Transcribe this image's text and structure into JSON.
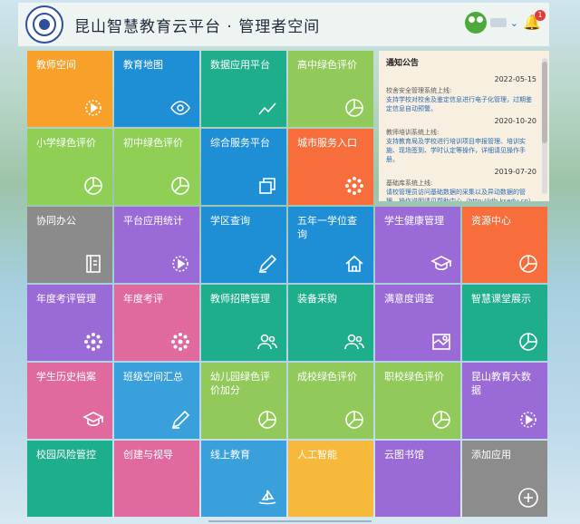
{
  "header": {
    "title": "昆山智慧教育云平台 · 管理者空间",
    "badge_count": "1"
  },
  "colors": {
    "orange": "#f7a02a",
    "blue": "#1e8ed5",
    "teal": "#1fae8c",
    "green": "#91c95a",
    "lightgreen": "#8fcf55",
    "purple": "#9a6ad6",
    "gray": "#8b8b8b",
    "pink": "#e06a9e",
    "red": "#f76d3b",
    "yellow": "#f6b93b",
    "sky": "#3aa0dc",
    "darkgray": "#8c8c8c"
  },
  "tiles": [
    {
      "label": "教师空间",
      "icon": "play-gear-icon"
    },
    {
      "label": "教育地图",
      "icon": "eye-icon"
    },
    {
      "label": "数据应用平台",
      "icon": "line-chart-icon"
    },
    {
      "label": "高中绿色评价",
      "icon": "pie-chart-icon"
    },
    {
      "label": "小学绿色评价",
      "icon": "pie-chart-icon"
    },
    {
      "label": "初中绿色评价",
      "icon": "pie-chart-icon"
    },
    {
      "label": "综合服务平台",
      "icon": "window-icon"
    },
    {
      "label": "城市服务入口",
      "icon": "dots-circle-icon"
    },
    {
      "label": "协同办公",
      "icon": "book-icon"
    },
    {
      "label": "平台应用统计",
      "icon": "play-gear-icon"
    },
    {
      "label": "学区查询",
      "icon": "pencil-icon"
    },
    {
      "label": "五年一学位查询",
      "icon": "house-icon"
    },
    {
      "label": "学生健康管理",
      "icon": "graduation-cap-icon"
    },
    {
      "label": "资源中心",
      "icon": "pie-chart-icon"
    },
    {
      "label": "年度考评管理",
      "icon": "dots-circle-icon"
    },
    {
      "label": "年度考评",
      "icon": "dots-circle-icon"
    },
    {
      "label": "教师招聘管理",
      "icon": "people-icon"
    },
    {
      "label": "装备采购",
      "icon": "people-icon"
    },
    {
      "label": "满意度调查",
      "icon": "map-icon"
    },
    {
      "label": "智慧课堂展示",
      "icon": "pie-chart-icon"
    },
    {
      "label": "学生历史档案",
      "icon": "graduation-cap-icon"
    },
    {
      "label": "班级空间汇总",
      "icon": "pencil-icon"
    },
    {
      "label": "幼儿园绿色评价加分",
      "icon": "pie-chart-icon"
    },
    {
      "label": "成校绿色评价",
      "icon": "pie-chart-icon"
    },
    {
      "label": "职校绿色评价",
      "icon": "pie-chart-icon"
    },
    {
      "label": "昆山教育大数据",
      "icon": "play-gear-icon"
    },
    {
      "label": "校园风险管控",
      "icon": ""
    },
    {
      "label": "创建与视导",
      "icon": ""
    },
    {
      "label": "线上教育",
      "icon": "boat-icon"
    },
    {
      "label": "人工智能",
      "icon": ""
    },
    {
      "label": "云图书馆",
      "icon": ""
    },
    {
      "label": "添加应用",
      "icon": "plus-circle-icon"
    }
  ],
  "notice": {
    "heading": "通知公告",
    "items": [
      {
        "date": "2022-05-15",
        "title": "校舍安全管理系统上线:",
        "body": "支持学校对校舍及鉴定信息进行电子化管理，过期鉴定信息自动预警。",
        "link": true
      },
      {
        "date": "2020-10-20",
        "title": "教师培训系统上线:",
        "body": "支持教育局及学校进行培训项目申报管理、培训实施、现场签到、学时认定等操作，详细请见操作手册。",
        "link": true
      },
      {
        "date": "2019-07-20",
        "title": "基础库系统上线:",
        "body": "请校管理员访问基础数据的采集以及异动数据的管理，操作说明请见帮助中心（http://jdb.ksedu.cn）",
        "link": true
      }
    ]
  }
}
